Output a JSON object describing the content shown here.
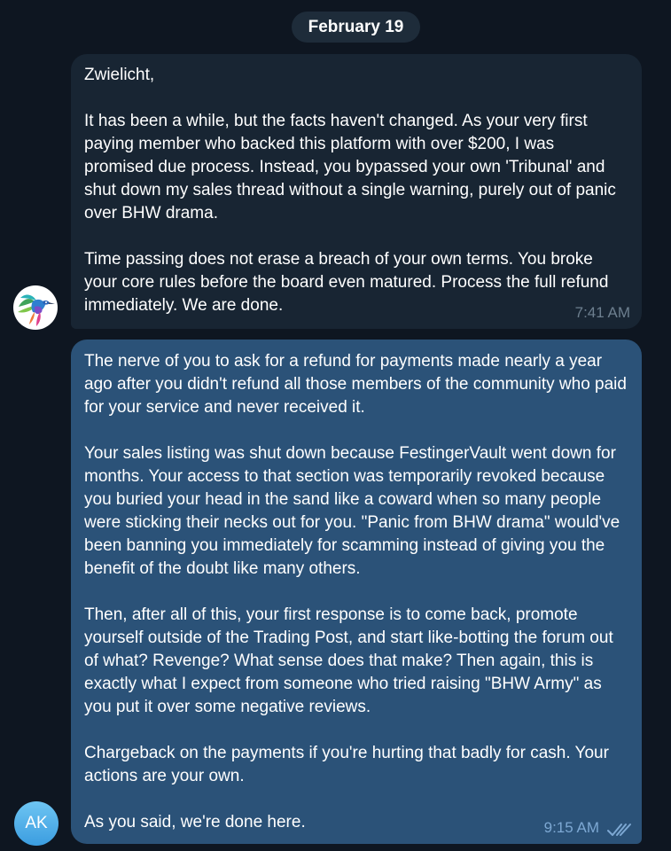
{
  "date_separator": "February 19",
  "incoming_message": {
    "paragraphs": [
      "Zwielicht,",
      "It has been a while, but the facts haven't changed. As your very first paying member who backed this platform with over $200, I was promised due process. Instead, you bypassed your own 'Tribunal' and shut down my sales thread without a single warning, purely out of panic over BHW drama.",
      "Time passing does not erase a breach of your own terms. You broke your core rules before the board even matured. Process the full refund immediately. We are done."
    ],
    "time": "7:41 AM",
    "avatar_icon": "hummingbird-icon"
  },
  "outgoing_message": {
    "paragraphs": [
      "The nerve of you to ask for a refund for payments made nearly a year ago after you didn't refund all those members of the community who paid for your service and never received it.",
      "Your sales listing was shut down because FestingerVault went down for months. Your access to that section was temporarily revoked because you buried your head in the sand like a coward when so many people were sticking their necks out for you. \"Panic from BHW drama\" would've been banning you immediately for scamming instead of giving you the benefit of the doubt like many others.",
      "Then, after all of this, your first response is to come back, promote yourself outside of the Trading Post, and start like-botting the forum out of what? Revenge? What sense does that make? Then again, this is exactly what I expect from someone who tried raising \"BHW Army\" as you put it over some negative reviews.",
      "Chargeback on the payments if you're hurting that badly for cash. Your actions are your own.",
      "As you said, we're done here."
    ],
    "time": "9:15 AM",
    "status_icon": "double-check-icon",
    "avatar_initials": "AK"
  },
  "colors": {
    "background": "#0e1621",
    "incoming_bubble": "#182533",
    "outgoing_bubble": "#2b5278",
    "read_check": "#7da8d3"
  }
}
